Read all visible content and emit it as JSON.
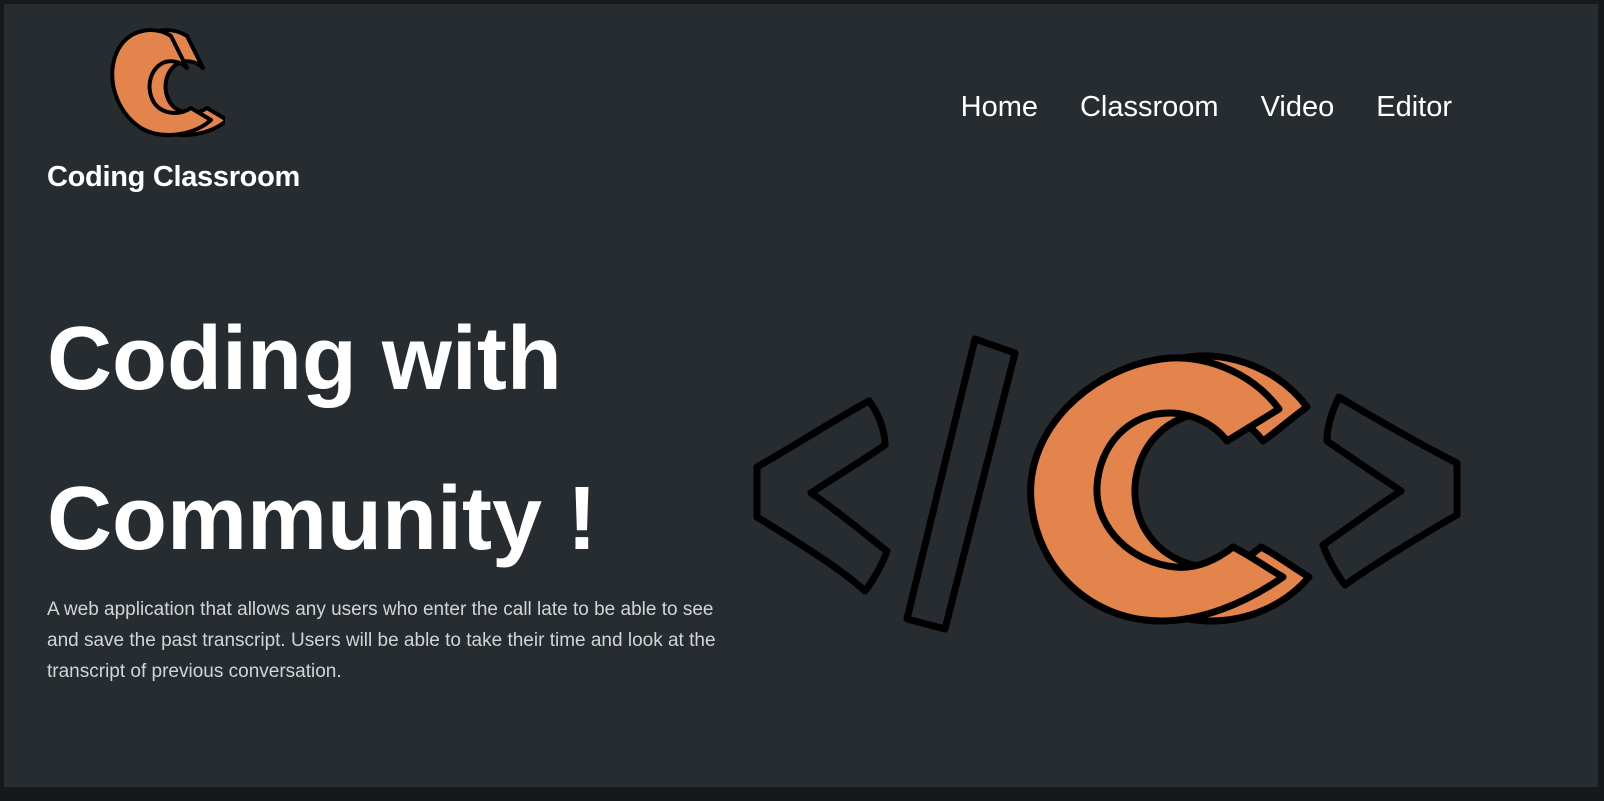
{
  "brand": {
    "name": "Coding Classroom",
    "logo_icon": "cc-logo-icon",
    "accent_color": "#e3844c"
  },
  "nav": {
    "items": [
      {
        "label": "Home"
      },
      {
        "label": "Classroom"
      },
      {
        "label": "Video"
      },
      {
        "label": "Editor"
      }
    ]
  },
  "hero": {
    "title_line1": "Coding with",
    "title_line2": "Community !",
    "description": "A web application that allows any users who enter the call late to be able to see and save the past transcript. Users will be able to take their time and look at the transcript of previous conversation.",
    "graphic_icon": "code-brackets-cc-icon"
  },
  "colors": {
    "background": "#262c30",
    "text": "#ffffff",
    "muted_text": "#d2d5d7",
    "accent": "#e3844c"
  }
}
